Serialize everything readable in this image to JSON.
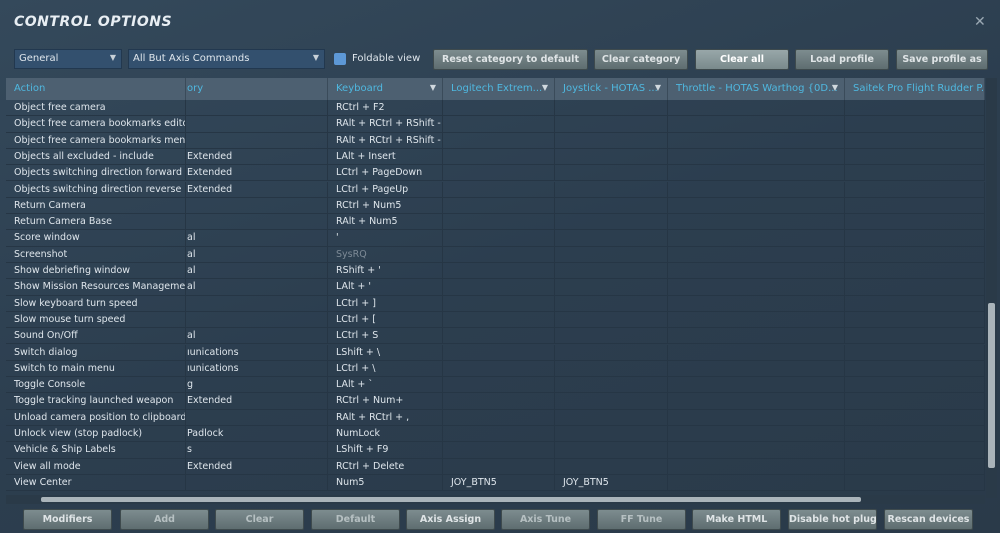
{
  "window": {
    "title": "CONTROL OPTIONS",
    "close_icon": "close-icon"
  },
  "toolbar": {
    "category_select": "General",
    "filter_select": "All But Axis Commands",
    "foldable_view_label": "Foldable view",
    "foldable_view_checked": false,
    "buttons": [
      "Reset category to default",
      "Clear category",
      "Clear all",
      "Load profile",
      "Save profile as"
    ]
  },
  "table": {
    "columns": [
      "Action",
      "ory",
      "Keyboard",
      "Logitech Extrem...",
      "Joystick - HOTAS ...",
      "Throttle - HOTAS Warthog {0D...",
      "Saitek Pro Flight Rudder P..."
    ],
    "rows": [
      [
        "Object free camera",
        "",
        "RCtrl + F2",
        "",
        ""
      ],
      [
        "Object free camera bookmarks editor",
        "",
        "RAlt + RCtrl + RShift -",
        "",
        ""
      ],
      [
        "Object free camera bookmarks menu",
        "",
        "RAlt + RCtrl + RShift -",
        "",
        ""
      ],
      [
        "Objects all excluded - include",
        "Extended",
        "LAlt + Insert",
        "",
        ""
      ],
      [
        "Objects switching direction forward",
        "Extended",
        "LCtrl + PageDown",
        "",
        ""
      ],
      [
        "Objects switching direction reverse",
        "Extended",
        "LCtrl + PageUp",
        "",
        ""
      ],
      [
        "Return Camera",
        "",
        "RCtrl + Num5",
        "",
        ""
      ],
      [
        "Return Camera Base",
        "",
        "RAlt + Num5",
        "",
        ""
      ],
      [
        "Score window",
        "al",
        "'",
        "",
        ""
      ],
      [
        "Screenshot",
        "al",
        "SysRQ",
        "",
        ""
      ],
      [
        "Show debriefing window",
        "al",
        "RShift + '",
        "",
        ""
      ],
      [
        "Show Mission Resources Management",
        "al",
        "LAlt + '",
        "",
        ""
      ],
      [
        "Slow keyboard turn speed",
        "",
        "LCtrl + ]",
        "",
        ""
      ],
      [
        "Slow mouse turn speed",
        "",
        "LCtrl + [",
        "",
        ""
      ],
      [
        "Sound On/Off",
        "al",
        "LCtrl + S",
        "",
        ""
      ],
      [
        "Switch dialog",
        "ıunications",
        "LShift + \\",
        "",
        ""
      ],
      [
        "Switch to main menu",
        "ıunications",
        "LCtrl + \\",
        "",
        ""
      ],
      [
        "Toggle Console",
        "g",
        "LAlt + `",
        "",
        ""
      ],
      [
        "Toggle tracking launched weapon",
        "Extended",
        "RCtrl + Num+",
        "",
        ""
      ],
      [
        "Unload camera position to clipboard",
        "",
        "RAlt + RCtrl + ,",
        "",
        ""
      ],
      [
        "Unlock view (stop padlock)",
        "Padlock",
        "NumLock",
        "",
        ""
      ],
      [
        "Vehicle & Ship Labels",
        "s",
        "LShift + F9",
        "",
        ""
      ],
      [
        "View all mode",
        "Extended",
        "RCtrl + Delete",
        "",
        ""
      ],
      [
        "View Center",
        "",
        "Num5",
        "JOY_BTN5",
        "JOY_BTN5"
      ]
    ]
  },
  "bottom_buttons": [
    "Modifiers",
    "Add",
    "Clear",
    "Default",
    "Axis Assign",
    "Axis Tune",
    "FF Tune",
    "Make HTML",
    "Disable hot plug",
    "Rescan devices"
  ],
  "colors": {
    "header_text": "#4fb8e0",
    "background": "#2f4152",
    "button": "#6e7d80"
  }
}
